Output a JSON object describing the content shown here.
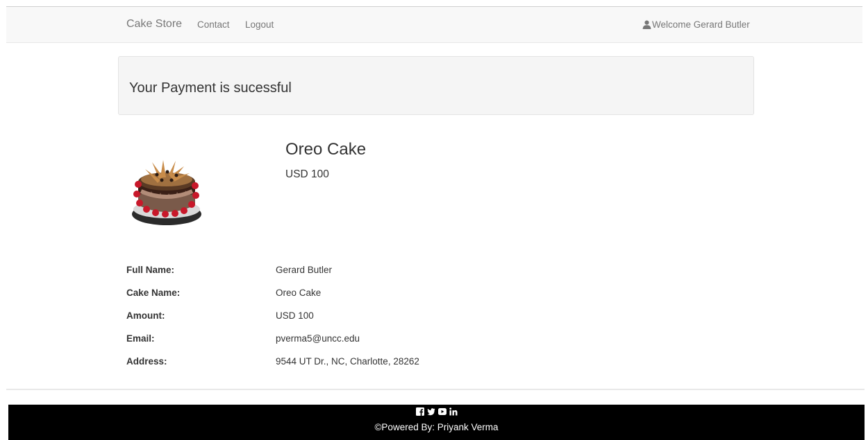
{
  "navbar": {
    "brand": "Cake Store",
    "links": [
      "Contact",
      "Logout"
    ],
    "welcome": "Welcome Gerard Butler",
    "welcome_icon": "user-icon"
  },
  "alert": {
    "message": "Your Payment is sucessful"
  },
  "product": {
    "name": "Oreo Cake",
    "price": "USD 100",
    "image_icon": "cake-image"
  },
  "details": [
    {
      "label": "Full Name:",
      "value": "Gerard Butler"
    },
    {
      "label": "Cake Name:",
      "value": "Oreo Cake"
    },
    {
      "label": "Amount:",
      "value": "USD 100"
    },
    {
      "label": "Email:",
      "value": "pverma5@uncc.edu"
    },
    {
      "label": "Address:",
      "value": "9544 UT Dr., NC, Charlotte, 28262"
    }
  ],
  "footer": {
    "social_icons": [
      "facebook-icon",
      "twitter-icon",
      "youtube-icon",
      "linkedin-icon"
    ],
    "text": "©Powered By: Priyank Verma"
  },
  "colors": {
    "navbar_bg": "#f8f8f8",
    "nav_text": "#777777",
    "alert_bg": "#f5f5f5",
    "footer_bg": "#000000"
  }
}
